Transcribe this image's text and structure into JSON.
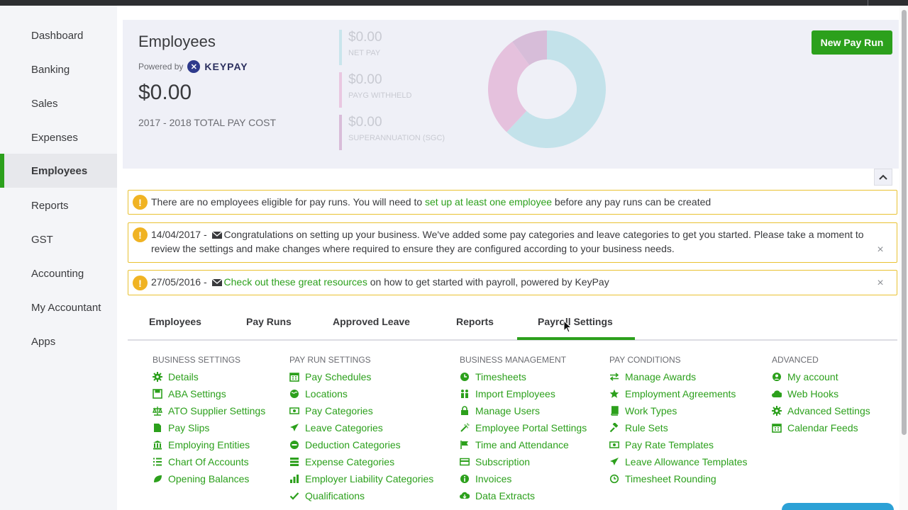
{
  "sidebar": {
    "items": [
      {
        "label": "Dashboard"
      },
      {
        "label": "Banking"
      },
      {
        "label": "Sales"
      },
      {
        "label": "Expenses"
      },
      {
        "label": "Employees",
        "active": true
      },
      {
        "label": "Reports"
      },
      {
        "label": "GST"
      },
      {
        "label": "Accounting"
      },
      {
        "label": "My Accountant"
      },
      {
        "label": "Apps"
      }
    ]
  },
  "hero": {
    "title": "Employees",
    "powered_by": "Powered by",
    "brand": "KEYPAY",
    "total": "$0.00",
    "total_label": "2017 - 2018 TOTAL PAY COST",
    "stats": [
      {
        "amount": "$0.00",
        "label": "NET PAY",
        "color": "#c9e5ec"
      },
      {
        "amount": "$0.00",
        "label": "PAYG WITHHELD",
        "color": "#e9c7e1"
      },
      {
        "amount": "$0.00",
        "label": "SUPERANNUATION (SGC)",
        "color": "#d9bcd9"
      }
    ],
    "new_pay_run_label": "New Pay Run"
  },
  "donut": {
    "segments": [
      {
        "label": "NET PAY",
        "fraction": 0.62,
        "color": "#c3e2ea"
      },
      {
        "label": "PAYG WITHHELD",
        "fraction": 0.28,
        "color": "#e5c1dd"
      },
      {
        "label": "SUPERANNUATION (SGC)",
        "fraction": 0.1,
        "color": "#d7bdd9"
      }
    ]
  },
  "alerts": [
    {
      "prefix": "There are no employees eligible for pay runs. You will need to ",
      "link": "set up at least one employee",
      "suffix": " before any pay runs can be created"
    },
    {
      "date": "14/04/2017 -",
      "text": "Congratulations on setting up your business. We've added some pay categories and leave categories to get you started. Please take a moment to review the settings and make changes where required to ensure they are configured according to your business needs."
    },
    {
      "date": "27/05/2016 -",
      "link": "Check out these great resources",
      "suffix": " on how to get started with payroll, powered by KeyPay"
    }
  ],
  "tabs": [
    {
      "label": "Employees"
    },
    {
      "label": "Pay Runs"
    },
    {
      "label": "Approved Leave"
    },
    {
      "label": "Reports"
    },
    {
      "label": "Payroll Settings",
      "active": true
    }
  ],
  "settings": {
    "business_settings": {
      "heading": "BUSINESS SETTINGS",
      "items": [
        {
          "label": "Details",
          "icon": "gear-icon"
        },
        {
          "label": "ABA Settings",
          "icon": "save-icon"
        },
        {
          "label": "ATO Supplier Settings",
          "icon": "scales-icon"
        },
        {
          "label": "Pay Slips",
          "icon": "file-icon"
        },
        {
          "label": "Employing Entities",
          "icon": "bank-icon"
        },
        {
          "label": "Chart Of Accounts",
          "icon": "list-icon"
        },
        {
          "label": "Opening Balances",
          "icon": "leaf-icon"
        }
      ]
    },
    "pay_run_settings": {
      "heading": "PAY RUN SETTINGS",
      "items": [
        {
          "label": "Pay Schedules",
          "icon": "calendar-icon"
        },
        {
          "label": "Locations",
          "icon": "globe-icon"
        },
        {
          "label": "Pay Categories",
          "icon": "money-icon"
        },
        {
          "label": "Leave Categories",
          "icon": "plane-icon"
        },
        {
          "label": "Deduction Categories",
          "icon": "minus-circle-icon"
        },
        {
          "label": "Expense Categories",
          "icon": "tasks-icon"
        },
        {
          "label": "Employer Liability Categories",
          "icon": "bar-chart-icon"
        },
        {
          "label": "Qualifications",
          "icon": "check-icon"
        }
      ]
    },
    "business_management": {
      "heading": "BUSINESS MANAGEMENT",
      "items": [
        {
          "label": "Timesheets",
          "icon": "clock-icon"
        },
        {
          "label": "Import Employees",
          "icon": "users-icon"
        },
        {
          "label": "Manage Users",
          "icon": "lock-icon"
        },
        {
          "label": "Employee Portal Settings",
          "icon": "wand-icon"
        },
        {
          "label": "Time and Attendance",
          "icon": "flag-icon"
        },
        {
          "label": "Subscription",
          "icon": "credit-card-icon"
        },
        {
          "label": "Invoices",
          "icon": "info-circle-icon"
        },
        {
          "label": "Data Extracts",
          "icon": "cloud-download-icon"
        }
      ]
    },
    "pay_conditions": {
      "heading": "PAY CONDITIONS",
      "items": [
        {
          "label": "Manage Awards",
          "icon": "exchange-icon"
        },
        {
          "label": "Employment Agreements",
          "icon": "star-icon"
        },
        {
          "label": "Work Types",
          "icon": "book-icon"
        },
        {
          "label": "Rule Sets",
          "icon": "gavel-icon"
        },
        {
          "label": "Pay Rate Templates",
          "icon": "money-icon"
        },
        {
          "label": "Leave Allowance Templates",
          "icon": "plane-icon"
        },
        {
          "label": "Timesheet Rounding",
          "icon": "clock-outline-icon"
        }
      ]
    },
    "advanced": {
      "heading": "ADVANCED",
      "items": [
        {
          "label": "My account",
          "icon": "user-circle-icon"
        },
        {
          "label": "Web Hooks",
          "icon": "cloud-icon"
        },
        {
          "label": "Advanced Settings",
          "icon": "gear-icon"
        },
        {
          "label": "Calendar Feeds",
          "icon": "calendar-icon"
        }
      ]
    }
  },
  "colors": {
    "brand_green": "#2ca01c",
    "warning": "#f0b323",
    "alert_border": "#e9c232"
  }
}
